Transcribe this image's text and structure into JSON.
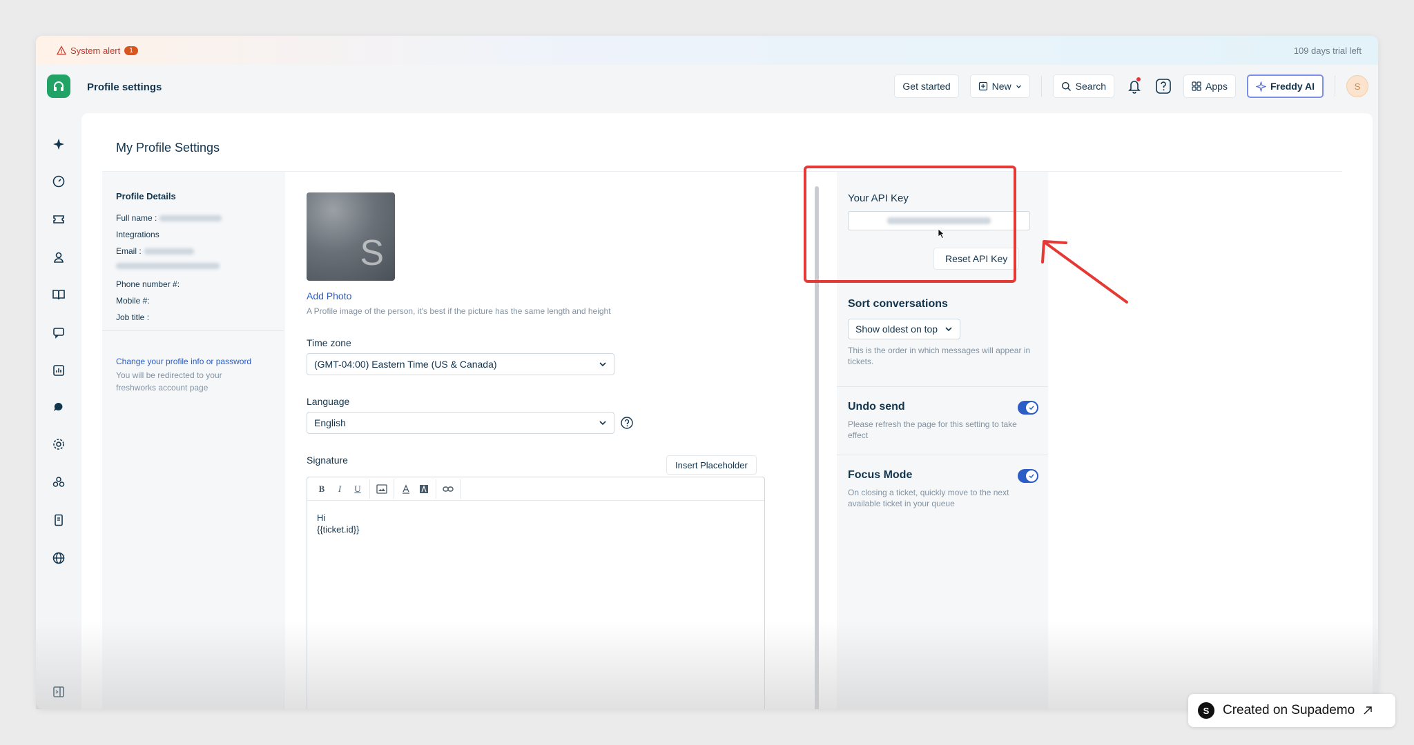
{
  "alert": {
    "label": "System alert",
    "count": "1",
    "trial": "109 days trial left"
  },
  "header": {
    "title": "Profile settings",
    "get_started": "Get started",
    "new_label": "New",
    "search_label": "Search",
    "apps_label": "Apps",
    "freddy_label": "Freddy AI",
    "avatar_initial": "S"
  },
  "page": {
    "heading": "My Profile Settings"
  },
  "profile_details": {
    "title": "Profile Details",
    "full_name_label": "Full name :",
    "integrations_label": "Integrations",
    "email_label": "Email :",
    "phone_label": "Phone number #:",
    "mobile_label": "Mobile #:",
    "job_title_label": "Job title :",
    "change_link": "Change your profile info or password",
    "redirect_note": "You will be redirected to your freshworks account page"
  },
  "photo": {
    "letter": "S",
    "add_label": "Add Photo",
    "hint": "A Profile image of the person, it's best if the picture has the same length and height"
  },
  "timezone": {
    "label": "Time zone",
    "value": "(GMT-04:00) Eastern Time (US & Canada)"
  },
  "language": {
    "label": "Language",
    "value": "English"
  },
  "signature": {
    "label": "Signature",
    "insert_placeholder": "Insert Placeholder",
    "line1": "Hi",
    "line2": "{{ticket.id}}"
  },
  "api_key": {
    "title": "Your API Key",
    "reset_label": "Reset API Key"
  },
  "sort": {
    "title": "Sort conversations",
    "value": "Show oldest on top",
    "desc": "This is the order in which messages will appear in tickets."
  },
  "undo_send": {
    "title": "Undo send",
    "desc": "Please refresh the page for this setting to take effect",
    "enabled": true
  },
  "focus_mode": {
    "title": "Focus Mode",
    "desc": "On closing a ticket, quickly move to the next available ticket in your queue",
    "enabled": true
  },
  "footer": {
    "supademo_label": "Created on Supademo",
    "supademo_logo": "S"
  },
  "colors": {
    "highlight": "#e53935",
    "toggle": "#2c5cc5",
    "link": "#2c5cc5",
    "brand": "#21a366"
  }
}
